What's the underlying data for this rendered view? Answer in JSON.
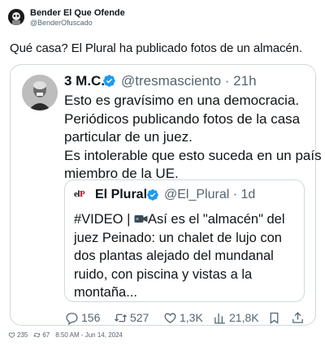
{
  "outer": {
    "name": "Bender El Que Ofende",
    "handle": "@BenderOfuscado",
    "text": "Qué casa? El Plural ha publicado fotos de un almacén."
  },
  "quoted": {
    "name": "3 M.C.",
    "handle_time": "@tresmasciento · 21h",
    "lines": [
      "Esto es gravísimo en una democracia.",
      "Periódicos publicando fotos de la casa",
      "particular de un juez.",
      "Es intolerable que esto suceda en un país",
      "miembro de la UE."
    ],
    "nested": {
      "logo_a": "el",
      "logo_b": "P",
      "name": "El Plural",
      "handle_time": "@El_Plural · 1d",
      "line1_a": "#VIDEO | ",
      "line1_b": "Así es el \"almacén\" del",
      "lines": [
        "juez Peinado: un chalet de lujo con",
        "dos plantas alejado del mundanal",
        "ruido, con piscina y vistas a la",
        "montaña..."
      ]
    },
    "actions": {
      "replies": "156",
      "retweets": "527",
      "likes": "1,3K",
      "views": "21,8K"
    }
  },
  "footer": {
    "likes": "235",
    "retweets": "67",
    "timestamp": "8:50 AM - Jun 14, 2024"
  },
  "colors": {
    "verified": "#1d9bf0",
    "muted": "#536471",
    "border": "#cfd9de",
    "text": "#0f1419",
    "logo_red": "#d6001c"
  }
}
